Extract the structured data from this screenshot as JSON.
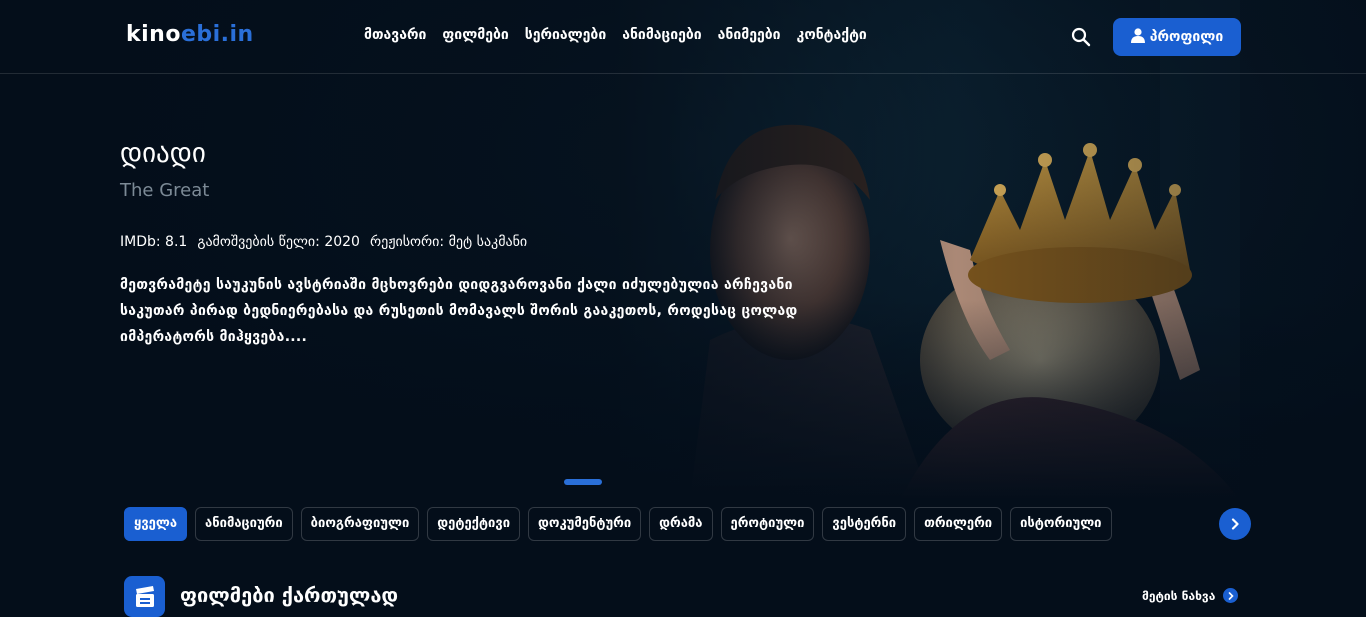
{
  "header": {
    "logo_part1": "kino",
    "logo_part2": "ebi.in",
    "nav": [
      "მთავარი",
      "ფილმები",
      "სერიალები",
      "ანიმაციები",
      "ანიმეები",
      "კონტაქტი"
    ],
    "search_icon": "search-icon",
    "profile_label": "პროფილი",
    "profile_icon": "user-icon"
  },
  "hero": {
    "title": "დიადი",
    "original_title": "The Great",
    "imdb": "IMDb: 8.1",
    "year": "გამოშვების წელი: 2020",
    "director": "რეჟისორი: მეტ საკმანი",
    "description": "მეთვრამეტე საუკუნის ავსტრიაში მცხოვრები დიდგვაროვანი ქალი იძულებულია არჩევანი საკუთარ პირად ბედნიერებასა და რუსეთის მომავალს შორის გააკეთოს, როდესაც ცოლად იმპერატორს მიჰყვება...."
  },
  "genres": {
    "items": [
      "ყველა",
      "ანიმაციური",
      "ბიოგრაფიული",
      "დეტექტივი",
      "დოკუმენტური",
      "დრამა",
      "ეროტიული",
      "ვესტერნი",
      "თრილერი",
      "ისტორიული"
    ],
    "active_index": 0,
    "next_icon": "chevron-right-icon"
  },
  "section": {
    "icon": "clapperboard-icon",
    "title": "ფილმები ქართულად",
    "see_more": "მეტის ნახვა"
  },
  "colors": {
    "accent": "#1a5fd1",
    "background": "#040e1a",
    "muted_text": "#7c8a96"
  }
}
